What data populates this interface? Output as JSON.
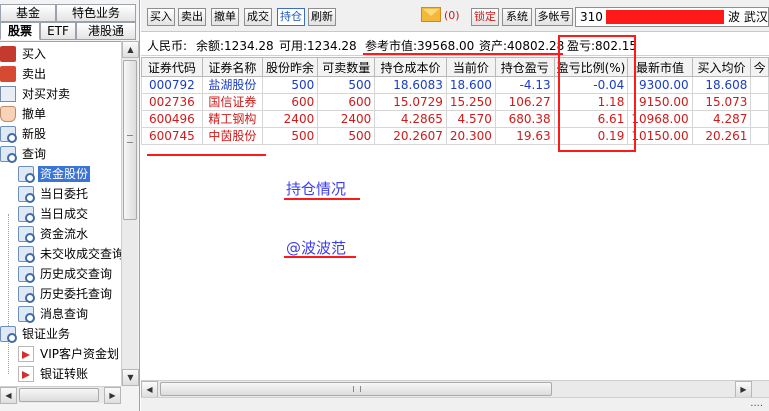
{
  "sidebar": {
    "tabs_row1": [
      "基金",
      "特色业务"
    ],
    "tabs_row2": [
      "股票",
      "ETF",
      "港股通"
    ],
    "tree": [
      {
        "label": "买入",
        "icon": "buy-icon"
      },
      {
        "label": "卖出",
        "icon": "sell-icon"
      },
      {
        "label": "对买对卖",
        "icon": "swap-icon"
      },
      {
        "label": "撤单",
        "icon": "cancel-hand-icon"
      },
      {
        "label": "新股",
        "icon": "search-doc-icon"
      },
      {
        "label": "查询",
        "icon": "search-doc-icon"
      },
      {
        "label": "资金股份",
        "icon": "search-doc-icon",
        "selected": true
      },
      {
        "label": "当日委托",
        "icon": "search-doc-icon"
      },
      {
        "label": "当日成交",
        "icon": "search-doc-icon"
      },
      {
        "label": "资金流水",
        "icon": "search-doc-icon"
      },
      {
        "label": "未交收成交查询",
        "icon": "search-doc-icon"
      },
      {
        "label": "历史成交查询",
        "icon": "search-doc-icon"
      },
      {
        "label": "历史委托查询",
        "icon": "search-doc-icon"
      },
      {
        "label": "消息查询",
        "icon": "search-doc-icon"
      },
      {
        "label": "银证业务",
        "icon": "search-doc-icon"
      },
      {
        "label": "VIP客户资金划",
        "icon": "arrow-icon"
      },
      {
        "label": "银证转账",
        "icon": "arrow-icon"
      }
    ]
  },
  "toolbar": {
    "buttons": [
      "买入",
      "卖出",
      "撤单",
      "成交",
      "持仓",
      "刷新"
    ],
    "active_button": "持仓",
    "mail_count": "(0)",
    "lock_label": "锁定",
    "system_label": "系统",
    "multi_account_label": "多帐号",
    "account_prefix": "310",
    "account_suffix": "波  武汉沿"
  },
  "summary": {
    "currency": "人民币:",
    "balance": "余额:1234.28",
    "available": "可用:1234.28",
    "market_value": "参考市值:39568.00",
    "assets": "资产:40802.28",
    "profit_loss": "盈亏:802.15"
  },
  "table": {
    "headers": [
      "证券代码",
      "证券名称",
      "股份昨余",
      "可卖数量",
      "持仓成本价",
      "当前价",
      "持仓盈亏",
      "盈亏比例(%)",
      "最新市值",
      "买入均价",
      "今"
    ],
    "rows": [
      {
        "code": "000792",
        "name": "盐湖股份",
        "prev_qty": "500",
        "sellable": "500",
        "cost": "18.6083",
        "price": "18.600",
        "pl": "-4.13",
        "pl_pct": "-0.04",
        "market": "9300.00",
        "avg_buy": "18.608",
        "color": "blue"
      },
      {
        "code": "002736",
        "name": "国信证券",
        "prev_qty": "600",
        "sellable": "600",
        "cost": "15.0729",
        "price": "15.250",
        "pl": "106.27",
        "pl_pct": "1.18",
        "market": "9150.00",
        "avg_buy": "15.073",
        "color": "red"
      },
      {
        "code": "600496",
        "name": "精工钢构",
        "prev_qty": "2400",
        "sellable": "2400",
        "cost": "4.2865",
        "price": "4.570",
        "pl": "680.38",
        "pl_pct": "6.61",
        "market": "10968.00",
        "avg_buy": "4.287",
        "color": "red"
      },
      {
        "code": "600745",
        "name": "中茵股份",
        "prev_qty": "500",
        "sellable": "500",
        "cost": "20.2607",
        "price": "20.300",
        "pl": "19.63",
        "pl_pct": "0.19",
        "market": "10150.00",
        "avg_buy": "20.261",
        "color": "red"
      }
    ]
  },
  "annotations": {
    "holdings": "持仓情况",
    "author": "@波波范"
  },
  "colors": {
    "annotation_blue": "#3d3df0",
    "highlight_red": "#ff1a1a",
    "profit_red": "#d01a1a",
    "loss_blue": "#1a3cc8",
    "selected_item": "#3a74d6"
  }
}
